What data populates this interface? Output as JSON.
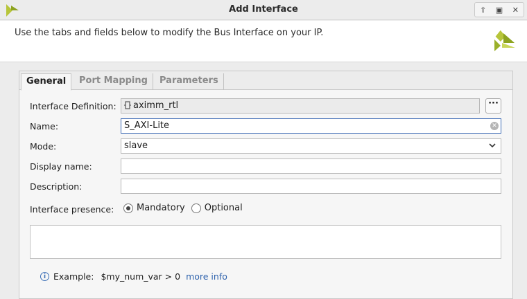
{
  "window": {
    "title": "Add Interface",
    "controls": [
      "restore-icon",
      "maximize-icon",
      "close-icon"
    ]
  },
  "header": {
    "description": "Use the tabs and fields below to modify the Bus Interface on your IP."
  },
  "tabs": [
    {
      "label": "General",
      "active": true
    },
    {
      "label": "Port Mapping",
      "active": false
    },
    {
      "label": "Parameters",
      "active": false
    }
  ],
  "form": {
    "interface_definition": {
      "label": "Interface Definition:",
      "value": "aximm_rtl"
    },
    "name": {
      "label": "Name:",
      "value": "S_AXI-Lite"
    },
    "mode": {
      "label": "Mode:",
      "value": "slave"
    },
    "display_name": {
      "label": "Display name:",
      "value": ""
    },
    "description": {
      "label": "Description:",
      "value": ""
    },
    "presence": {
      "label": "Interface presence:",
      "options": [
        "Mandatory",
        "Optional"
      ],
      "selected": "Mandatory"
    },
    "browse_label": "···"
  },
  "example": {
    "label": "Example:",
    "expression": "$my_num_var > 0",
    "link": "more info"
  },
  "colors": {
    "accent": "#3d6ab5",
    "logo_green": "#9ab02a"
  }
}
